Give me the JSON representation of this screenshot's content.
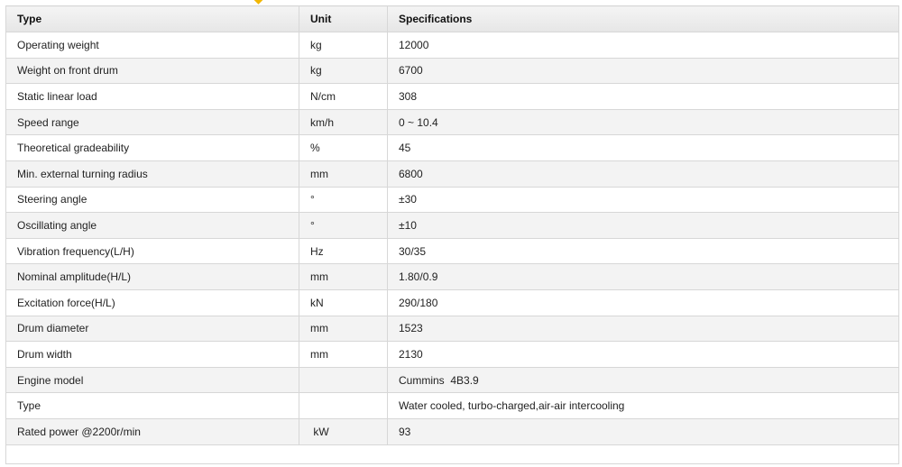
{
  "table": {
    "headers": [
      "Type",
      "Unit",
      "Specifications"
    ],
    "rows": [
      {
        "type": "Operating weight",
        "unit": "kg",
        "spec": "12000"
      },
      {
        "type": "Weight on front drum",
        "unit": "kg",
        "spec": "6700"
      },
      {
        "type": "Static linear load",
        "unit": "N/cm",
        "spec": "308"
      },
      {
        "type": "Speed range",
        "unit": "km/h",
        "spec": "0 ~ 10.4"
      },
      {
        "type": "Theoretical gradeability",
        "unit": "%",
        "spec": "45"
      },
      {
        "type": "Min. external turning radius",
        "unit": "mm",
        "spec": "6800"
      },
      {
        "type": "Steering angle",
        "unit": "°",
        "spec": "±30"
      },
      {
        "type": "Oscillating angle",
        "unit": "°",
        "spec": "±10"
      },
      {
        "type": "Vibration frequency(L/H)",
        "unit": "Hz",
        "spec": "30/35"
      },
      {
        "type": "Nominal amplitude(H/L)",
        "unit": "mm",
        "spec": "1.80/0.9"
      },
      {
        "type": "Excitation force(H/L)",
        "unit": "kN",
        "spec": "290/180"
      },
      {
        "type": "Drum diameter",
        "unit": "mm",
        "spec": "1523"
      },
      {
        "type": "Drum width",
        "unit": "mm",
        "spec": "2130"
      },
      {
        "type": "Engine model",
        "unit": "",
        "spec": "Cummins  4B3.9"
      },
      {
        "type": "Type",
        "unit": "",
        "spec": "Water cooled, turbo-charged,air-air intercooling"
      },
      {
        "type": "Rated power @2200r/min",
        "unit": " kW",
        "spec": "93"
      }
    ]
  },
  "colors": {
    "marker": "#f2b705",
    "border": "#d7d7d7",
    "stripe": "#f3f3f3"
  }
}
